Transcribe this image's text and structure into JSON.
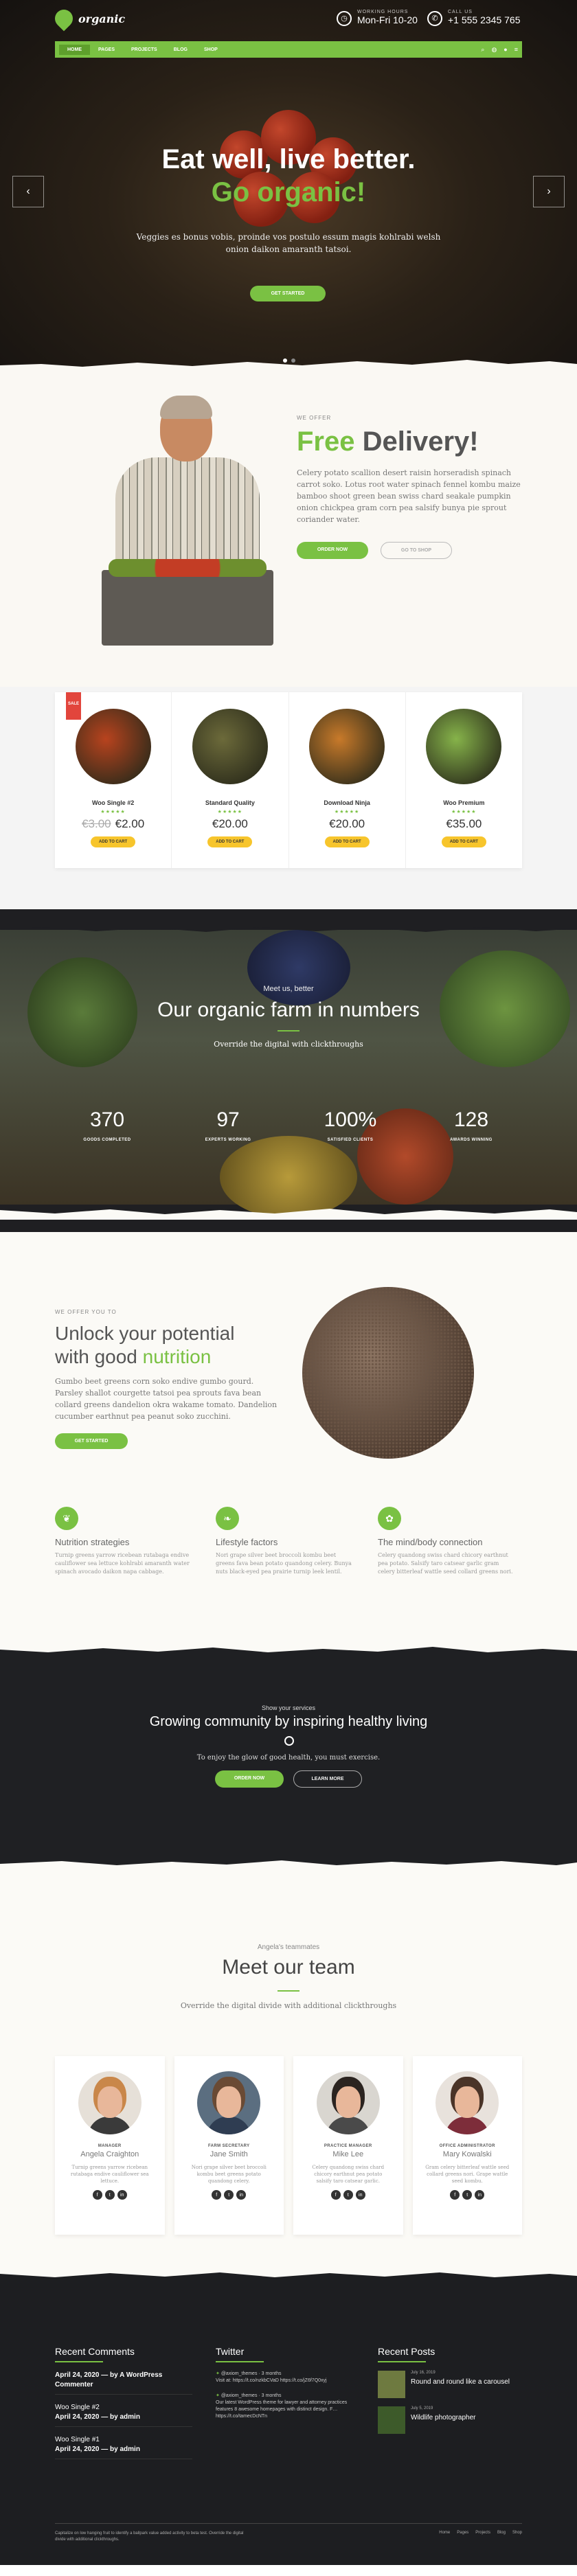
{
  "header": {
    "logo": "organic",
    "working_hours_label": "WORKING HOURS",
    "working_hours": "Mon-Fri 10-20",
    "call_label": "CALL US",
    "phone": "+1 555 2345 765",
    "nav": [
      "HOME",
      "PAGES",
      "PROJECTS",
      "BLOG",
      "SHOP"
    ]
  },
  "hero": {
    "title": "Eat well, live better.",
    "subtitle": "Go organic!",
    "text": "Veggies es bonus vobis, proinde vos postulo essum magis kohlrabi welsh onion daikon amaranth tatsoi.",
    "cta": "GET STARTED",
    "prev": "‹",
    "next": "›"
  },
  "delivery": {
    "eyebrow": "WE OFFER",
    "title_green": "Free",
    "title_dark": "Delivery!",
    "text": "Celery potato scallion desert raisin horseradish spinach carrot soko. Lotus root water spinach fennel kombu maize bamboo shoot green bean swiss chard seakale pumpkin onion chickpea gram corn pea salsify bunya pie sprout coriander water.",
    "btn_order": "ORDER NOW",
    "btn_shop": "GO TO SHOP"
  },
  "products": [
    {
      "name": "Woo Single #2",
      "old_price": "€3.00",
      "price": "€2.00",
      "sale": "SALE",
      "btn": "ADD TO CART",
      "stars": "★★★★★",
      "color": "#b8431e"
    },
    {
      "name": "Standard Quality",
      "old_price": "",
      "price": "€20.00",
      "sale": "",
      "btn": "ADD TO CART",
      "stars": "★★★★★",
      "color": "#6c6a3a"
    },
    {
      "name": "Download Ninja",
      "old_price": "",
      "price": "€20.00",
      "sale": "",
      "btn": "ADD TO CART",
      "stars": "★★★★★",
      "color": "#c87a2a"
    },
    {
      "name": "Woo Premium",
      "old_price": "",
      "price": "€35.00",
      "sale": "",
      "btn": "ADD TO CART",
      "stars": "★★★★★",
      "color": "#86b34a"
    }
  ],
  "numbers": {
    "eyebrow": "Meet us, better",
    "title": "Our organic farm in numbers",
    "text": "Override the digital with clickthroughs",
    "stats": [
      {
        "value": "370",
        "label": "GOODS COMPLETED"
      },
      {
        "value": "97",
        "label": "EXPERTS WORKING"
      },
      {
        "value": "100%",
        "label": "SATISFIED CLIENTS"
      },
      {
        "value": "128",
        "label": "AWARDS WINNING"
      }
    ]
  },
  "nutrition": {
    "eyebrow": "WE OFFER YOU TO",
    "title_a": "Unlock your potential",
    "title_b": "with good",
    "title_green": "nutrition",
    "text": "Gumbo beet greens corn soko endive gumbo gourd. Parsley shallot courgette tatsoi pea sprouts fava bean collard greens dandelion okra wakame tomato. Dandelion cucumber earthnut pea peanut soko zucchini.",
    "cta": "GET STARTED",
    "features": [
      {
        "title": "Nutrition strategies",
        "text": "Turnip greens yarrow ricebean rutabaga endive cauliflower sea lettuce kohlrabi amaranth water spinach avocado daikon napa cabbage."
      },
      {
        "title": "Lifestyle factors",
        "text": "Nori grape silver beet broccoli kombu beet greens fava bean potato quandong celery. Bunya nuts black-eyed pea prairie turnip leek lentil."
      },
      {
        "title": "The mind/body connection",
        "text": "Celery quandong swiss chard chicory earthnut pea potato. Salsify taro catsear garlic gram celery bitterleaf wattle seed collard greens nori."
      }
    ]
  },
  "community": {
    "eyebrow": "Show your services",
    "title": "Growing community by inspiring healthy living",
    "text": "To enjoy the glow of good health, you must exercise.",
    "btn_order": "ORDER NOW",
    "btn_learn": "LEARN MORE"
  },
  "team": {
    "eyebrow": "Angela's teammates",
    "title": "Meet our team",
    "text": "Override the digital divide with additional clickthroughs",
    "members": [
      {
        "role": "MANAGER",
        "name": "Angela Craighton",
        "bio": "Turnip greens yarrow ricebean rutabaga endive cauliflower sea lettuce.",
        "hair": "#c9874a",
        "shirt": "#3a3a3a"
      },
      {
        "role": "FARM SECRETARY",
        "name": "Jane Smith",
        "bio": "Nori grape silver beet broccoli kombu beet greens potato quandong celery.",
        "hair": "#6a4a34",
        "shirt": "#2f3d52"
      },
      {
        "role": "PRACTICE MANAGER",
        "name": "Mike Lee",
        "bio": "Celery quandong swiss chard chicory earthnut pea potato salsify taro catsear garlic.",
        "hair": "#2b2420",
        "shirt": "#4a4a4a"
      },
      {
        "role": "OFFICE ADMINISTRATOR",
        "name": "Mary Kowalski",
        "bio": "Gram celery bitterleaf wattle seed collard greens nori. Grape wattle seed kombu.",
        "hair": "#4a3428",
        "shirt": "#7d2d3a"
      }
    ],
    "social": [
      "f",
      "t",
      "in"
    ]
  },
  "footer": {
    "comments_title": "Recent Comments",
    "comments": [
      {
        "meta": "April 24, 2020 — by A WordPress Commenter",
        "title": ""
      },
      {
        "meta": "Woo Single #2",
        "title": "April 24, 2020 — by admin"
      },
      {
        "meta": "Woo Single #1",
        "title": "April 24, 2020 — by admin"
      }
    ],
    "twitter_title": "Twitter",
    "tweets": [
      {
        "handle": "@axiom_themes · 3 months",
        "text": "Visit at: https://t.co/nzkbCVaD https://t.co/jZ6f7Q0xyj"
      },
      {
        "handle": "@axiom_themes · 3 months",
        "text": "Our latest WordPress theme for lawyer and attorney practices features 8 awesome homepages with distinct design. F… https://t.co/tamecDcNTn"
      }
    ],
    "posts_title": "Recent Posts",
    "posts": [
      {
        "date": "July 16, 2019",
        "title": "Round and round like a carousel"
      },
      {
        "date": "July 5, 2019",
        "title": "Wildlife photographer"
      }
    ],
    "copyright": "Capitalize on low hanging fruit to identify a ballpark value added activity to beta test. Override the digital divide with additional clickthroughs.",
    "links": [
      "Home",
      "Pages",
      "Projects",
      "Blog",
      "Shop"
    ]
  }
}
